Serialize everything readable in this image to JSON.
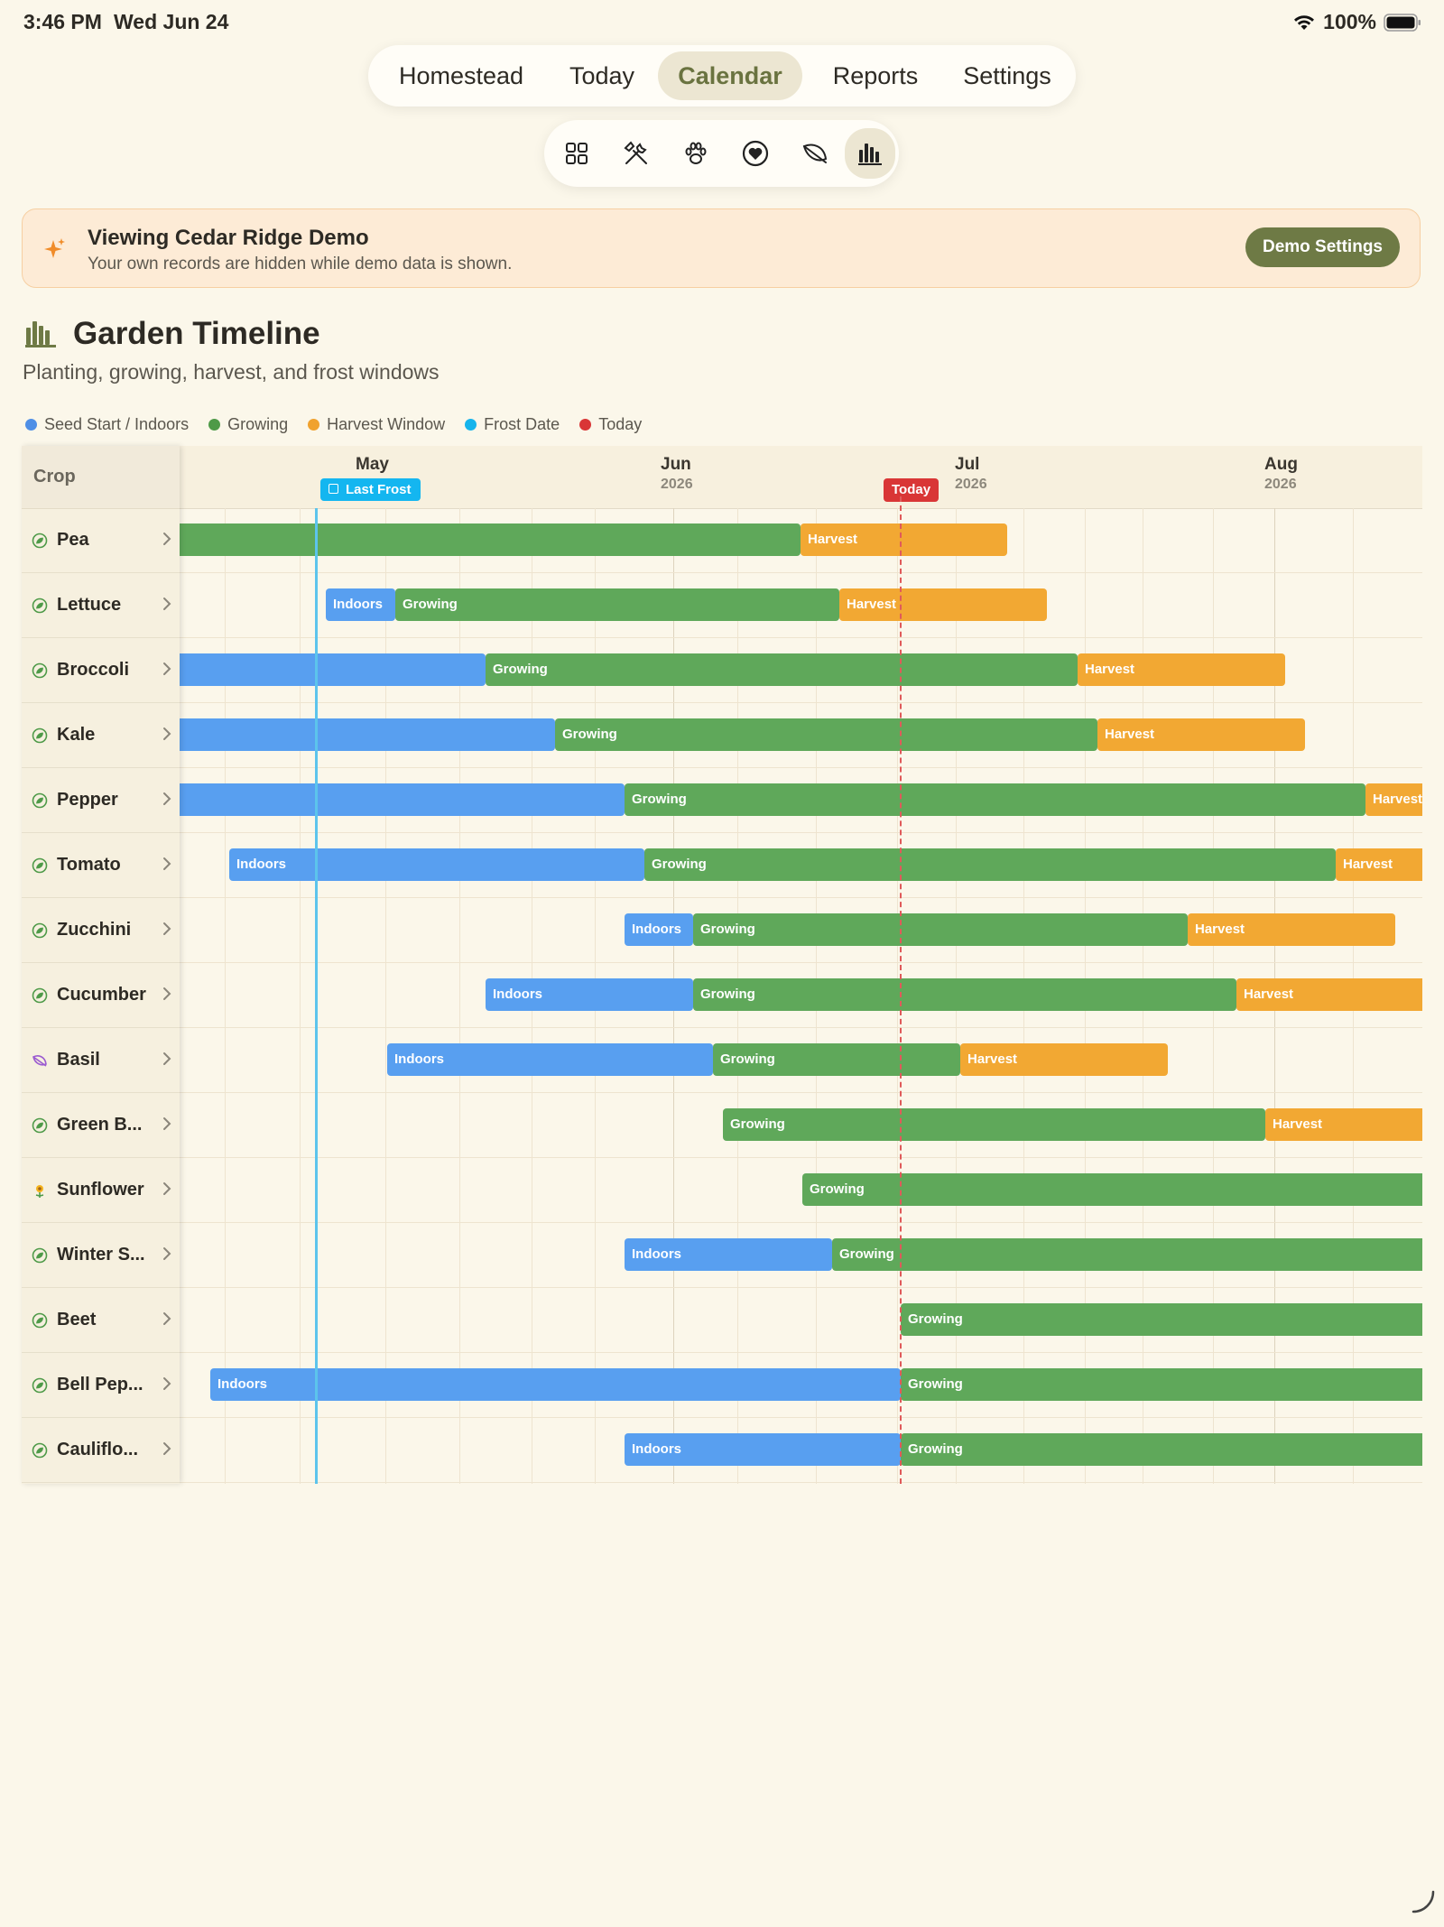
{
  "status_bar": {
    "time": "3:46 PM",
    "date": "Wed Jun 24",
    "battery": "100%"
  },
  "tabs": [
    {
      "label": "Homestead",
      "active": false
    },
    {
      "label": "Today",
      "active": false
    },
    {
      "label": "Calendar",
      "active": true
    },
    {
      "label": "Reports",
      "active": false
    },
    {
      "label": "Settings",
      "active": false
    }
  ],
  "icon_bar": [
    {
      "icon": "grid-icon",
      "active": false
    },
    {
      "icon": "tools-icon",
      "active": false
    },
    {
      "icon": "paw-icon",
      "active": false
    },
    {
      "icon": "heart-icon",
      "active": false
    },
    {
      "icon": "leaf-icon",
      "active": false
    },
    {
      "icon": "chart-icon",
      "active": true
    }
  ],
  "banner": {
    "title": "Viewing Cedar Ridge Demo",
    "subtitle": "Your own records are hidden while demo data is shown.",
    "button": "Demo Settings",
    "icon": "sparkle-icon"
  },
  "page": {
    "title": "Garden Timeline",
    "subtitle": "Planting, growing, harvest, and frost windows",
    "icon": "bar-chart-icon"
  },
  "legend": [
    {
      "label": "Seed Start / Indoors",
      "color": "#4f8fe6"
    },
    {
      "label": "Growing",
      "color": "#4e9a48"
    },
    {
      "label": "Harvest Window",
      "color": "#f0a22e"
    },
    {
      "label": "Frost Date",
      "color": "#16b4ec"
    },
    {
      "label": "Today",
      "color": "#d93636"
    }
  ],
  "colors": {
    "indoors": "#589ff0",
    "growing": "#5fa85a",
    "harvest": "#f2a833",
    "accent": "#6e7a45"
  },
  "timeline": {
    "crop_header": "Crop",
    "months": [
      {
        "name": "May",
        "year": ""
      },
      {
        "name": "Jun",
        "year": "2026"
      },
      {
        "name": "Jul",
        "year": "2026"
      },
      {
        "name": "Aug",
        "year": "2026"
      }
    ],
    "frost_label": "Last Frost",
    "today_label": "Today",
    "crops": [
      {
        "name": "Pea",
        "icon": "sprout-icon",
        "bars": [
          {
            "kind": "growing",
            "label": ""
          },
          {
            "kind": "harvest",
            "label": "Harvest"
          }
        ]
      },
      {
        "name": "Lettuce",
        "icon": "sprout-icon",
        "bars": [
          {
            "kind": "indoors",
            "label": "Indoors"
          },
          {
            "kind": "growing",
            "label": "Growing"
          },
          {
            "kind": "harvest",
            "label": "Harvest"
          }
        ]
      },
      {
        "name": "Broccoli",
        "icon": "sprout-icon",
        "bars": [
          {
            "kind": "indoors",
            "label": ""
          },
          {
            "kind": "growing",
            "label": "Growing"
          },
          {
            "kind": "harvest",
            "label": "Harvest"
          }
        ]
      },
      {
        "name": "Kale",
        "icon": "sprout-icon",
        "bars": [
          {
            "kind": "indoors",
            "label": ""
          },
          {
            "kind": "growing",
            "label": "Growing"
          },
          {
            "kind": "harvest",
            "label": "Harvest"
          }
        ]
      },
      {
        "name": "Pepper",
        "icon": "sprout-icon",
        "bars": [
          {
            "kind": "indoors",
            "label": ""
          },
          {
            "kind": "growing",
            "label": "Growing"
          },
          {
            "kind": "harvest",
            "label": "Harvest"
          }
        ]
      },
      {
        "name": "Tomato",
        "icon": "sprout-icon",
        "bars": [
          {
            "kind": "indoors",
            "label": "Indoors"
          },
          {
            "kind": "growing",
            "label": "Growing"
          },
          {
            "kind": "harvest",
            "label": "Harvest"
          }
        ]
      },
      {
        "name": "Zucchini",
        "icon": "sprout-icon",
        "bars": [
          {
            "kind": "indoors",
            "label": "Indoors"
          },
          {
            "kind": "growing",
            "label": "Growing"
          },
          {
            "kind": "harvest",
            "label": "Harvest"
          }
        ]
      },
      {
        "name": "Cucumber",
        "icon": "sprout-icon",
        "bars": [
          {
            "kind": "indoors",
            "label": "Indoors"
          },
          {
            "kind": "growing",
            "label": "Growing"
          },
          {
            "kind": "harvest",
            "label": "Harvest"
          }
        ]
      },
      {
        "name": "Basil",
        "icon": "leaf-icon",
        "bars": [
          {
            "kind": "indoors",
            "label": "Indoors"
          },
          {
            "kind": "growing",
            "label": "Growing"
          },
          {
            "kind": "harvest",
            "label": "Harvest"
          }
        ]
      },
      {
        "name": "Green B...",
        "icon": "sprout-icon",
        "bars": [
          {
            "kind": "growing",
            "label": "Growing"
          },
          {
            "kind": "harvest",
            "label": "Harvest"
          }
        ]
      },
      {
        "name": "Sunflower",
        "icon": "flower-icon",
        "bars": [
          {
            "kind": "growing",
            "label": "Growing"
          }
        ]
      },
      {
        "name": "Winter S...",
        "icon": "sprout-icon",
        "bars": [
          {
            "kind": "indoors",
            "label": "Indoors"
          },
          {
            "kind": "growing",
            "label": "Growing"
          }
        ]
      },
      {
        "name": "Beet",
        "icon": "sprout-icon",
        "bars": [
          {
            "kind": "growing",
            "label": "Growing"
          }
        ]
      },
      {
        "name": "Bell Pep...",
        "icon": "sprout-icon",
        "bars": [
          {
            "kind": "indoors",
            "label": "Indoors"
          },
          {
            "kind": "growing",
            "label": "Growing"
          }
        ]
      },
      {
        "name": "Cauliflo...",
        "icon": "sprout-icon",
        "bars": [
          {
            "kind": "indoors",
            "label": "Indoors"
          },
          {
            "kind": "growing",
            "label": "Growing"
          }
        ]
      }
    ]
  }
}
